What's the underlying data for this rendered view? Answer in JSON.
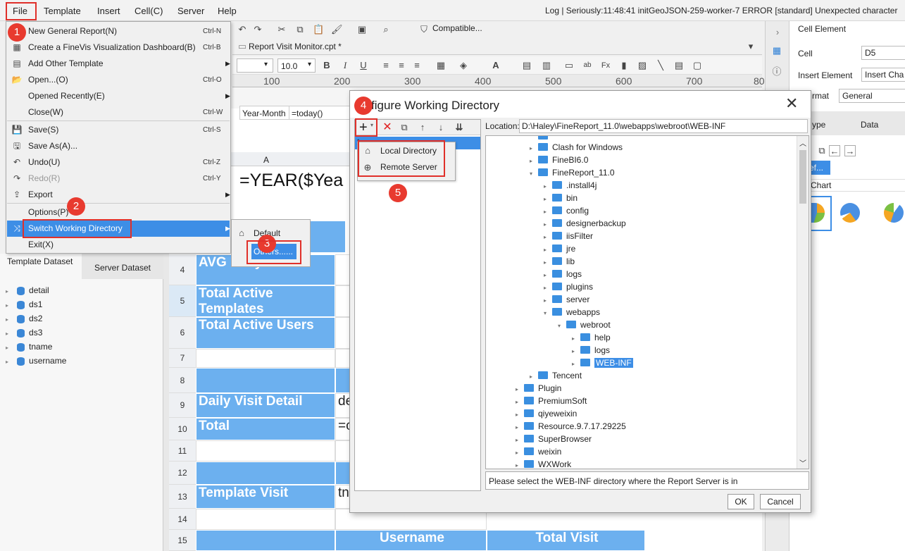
{
  "menubar": {
    "file": "File",
    "template": "Template",
    "insert": "Insert",
    "cell": "Cell(C)",
    "server": "Server",
    "help": "Help",
    "log": "Log | Seriously:11:48:41 initGeoJSON-259-worker-7 ERROR [standard] Unexpected character"
  },
  "toolbar": {
    "compatible": "Compatible..."
  },
  "tab": {
    "title": "Report Visit Monitor.cpt *"
  },
  "format": {
    "font_size": "10.0",
    "font_size_arrow": "▾"
  },
  "ruler": [
    "100",
    "200",
    "300",
    "400",
    "500",
    "600",
    "700",
    "80"
  ],
  "sheet": {
    "col_a": "A",
    "year_formula": "=YEAR($Yea",
    "year_month": "Year-Month",
    "today": "=today()",
    "rows": [
      {
        "n": "4",
        "label": "AVG Daily Visit"
      },
      {
        "n": "5",
        "label": "Total Active Templates"
      },
      {
        "n": "6",
        "label": "Total Active Users"
      },
      {
        "n": "7",
        "label": ""
      },
      {
        "n": "8",
        "label": ""
      },
      {
        "n": "9",
        "label": "Daily Visit Detail",
        "b": "de"
      },
      {
        "n": "10",
        "label": "Total",
        "b": "=c"
      },
      {
        "n": "11",
        "label": ""
      },
      {
        "n": "12",
        "label": ""
      },
      {
        "n": "13",
        "label": "Template Visit",
        "b": "tn"
      },
      {
        "n": "14",
        "label": ""
      },
      {
        "n": "15",
        "label": "",
        "b": "Username",
        "c": "Total Visit"
      }
    ]
  },
  "leftpanel": {
    "tab1": "Template Dataset",
    "tab2": "Server Dataset",
    "datasets": [
      "detail",
      "ds1",
      "ds2",
      "ds3",
      "tname",
      "username"
    ]
  },
  "rightpanel": {
    "cell_element": "Cell Element",
    "cell_label": "Cell",
    "cell_value": "D5",
    "insert_element": "Insert Element",
    "insert_value": "Insert Cha",
    "format_label": "rmat",
    "format_value": "General",
    "tab_type": "ype",
    "tab_data": "Data",
    "ref": "ef...",
    "chart": "Chart"
  },
  "filemenu": [
    {
      "label": "New General Report(N)",
      "sc": "Ctrl-N",
      "icon": "🗋"
    },
    {
      "label": "Create a FineVis Visualization Dashboard(B)",
      "sc": "Ctrl-B",
      "icon": "▦"
    },
    {
      "label": "Add Other Template",
      "sc": "",
      "arrow": "▶",
      "icon": "▤"
    },
    {
      "label": "Open...(O)",
      "sc": "Ctrl-O",
      "icon": "📂"
    },
    {
      "label": "Opened Recently(E)",
      "sc": "",
      "arrow": "▶",
      "icon": ""
    },
    {
      "label": "Close(W)",
      "sc": "Ctrl-W",
      "icon": ""
    },
    {
      "label": "Save(S)",
      "sc": "Ctrl-S",
      "icon": "💾"
    },
    {
      "label": "Save As(A)...",
      "sc": "",
      "icon": "🖫"
    },
    {
      "label": "Undo(U)",
      "sc": "Ctrl-Z",
      "icon": "↶"
    },
    {
      "label": "Redo(R)",
      "sc": "Ctrl-Y",
      "icon": "↷"
    },
    {
      "label": "Export",
      "sc": "",
      "arrow": "▶",
      "icon": "⇪"
    },
    {
      "label": "Options(P)",
      "sc": "",
      "icon": ""
    },
    {
      "label": "Switch Working Directory",
      "sc": "",
      "arrow": "▶",
      "icon": "⤨"
    },
    {
      "label": "Exit(X)",
      "sc": "",
      "icon": ""
    }
  ],
  "submenu": {
    "default": "Default",
    "others": "Others......"
  },
  "dialog": {
    "title": "Configure Working Directory",
    "title_visible": "figure Working Directory",
    "location_label": "Location:",
    "location_value": "D:\\Haley\\FineReport_11.0\\webapps\\webroot\\WEB-INF",
    "add_local": "Local Directory",
    "add_remote": "Remote Server",
    "hint": "Please select the WEB-INF directory where the Report Server is in",
    "ok": "OK",
    "cancel": "Cancel",
    "list_first": "1",
    "tree": [
      {
        "name": "Clash for Windows",
        "d": 2,
        "open": false
      },
      {
        "name": "FineBI6.0",
        "d": 2,
        "open": false
      },
      {
        "name": "FineReport_11.0",
        "d": 2,
        "open": true
      },
      {
        "name": ".install4j",
        "d": 3,
        "open": false
      },
      {
        "name": "bin",
        "d": 3,
        "open": false
      },
      {
        "name": "config",
        "d": 3,
        "open": false
      },
      {
        "name": "designerbackup",
        "d": 3,
        "open": false
      },
      {
        "name": "iisFilter",
        "d": 3,
        "open": false
      },
      {
        "name": "jre",
        "d": 3,
        "open": false
      },
      {
        "name": "lib",
        "d": 3,
        "open": false
      },
      {
        "name": "logs",
        "d": 3,
        "open": false
      },
      {
        "name": "plugins",
        "d": 3,
        "open": false
      },
      {
        "name": "server",
        "d": 3,
        "open": false
      },
      {
        "name": "webapps",
        "d": 3,
        "open": true
      },
      {
        "name": "webroot",
        "d": 4,
        "open": true
      },
      {
        "name": "help",
        "d": 5,
        "open": false
      },
      {
        "name": "logs",
        "d": 5,
        "open": false
      },
      {
        "name": "WEB-INF",
        "d": 5,
        "open": false,
        "selected": true
      },
      {
        "name": "Tencent",
        "d": 2,
        "open": false
      },
      {
        "name": "Plugin",
        "d": 1,
        "open": false
      },
      {
        "name": "PremiumSoft",
        "d": 1,
        "open": false
      },
      {
        "name": "qiyeweixin",
        "d": 1,
        "open": false
      },
      {
        "name": "Resource.9.7.17.29225",
        "d": 1,
        "open": false
      },
      {
        "name": "SuperBrowser",
        "d": 1,
        "open": false
      },
      {
        "name": "weixin",
        "d": 1,
        "open": false
      },
      {
        "name": "WXWork",
        "d": 1,
        "open": false
      }
    ]
  },
  "badges": [
    "1",
    "2",
    "3",
    "4",
    "5"
  ],
  "colors": {
    "accent": "#3d8ee6",
    "cell_blue": "#6cb0ef",
    "badge": "#e83a2f",
    "folder": "#3a8fe0"
  }
}
